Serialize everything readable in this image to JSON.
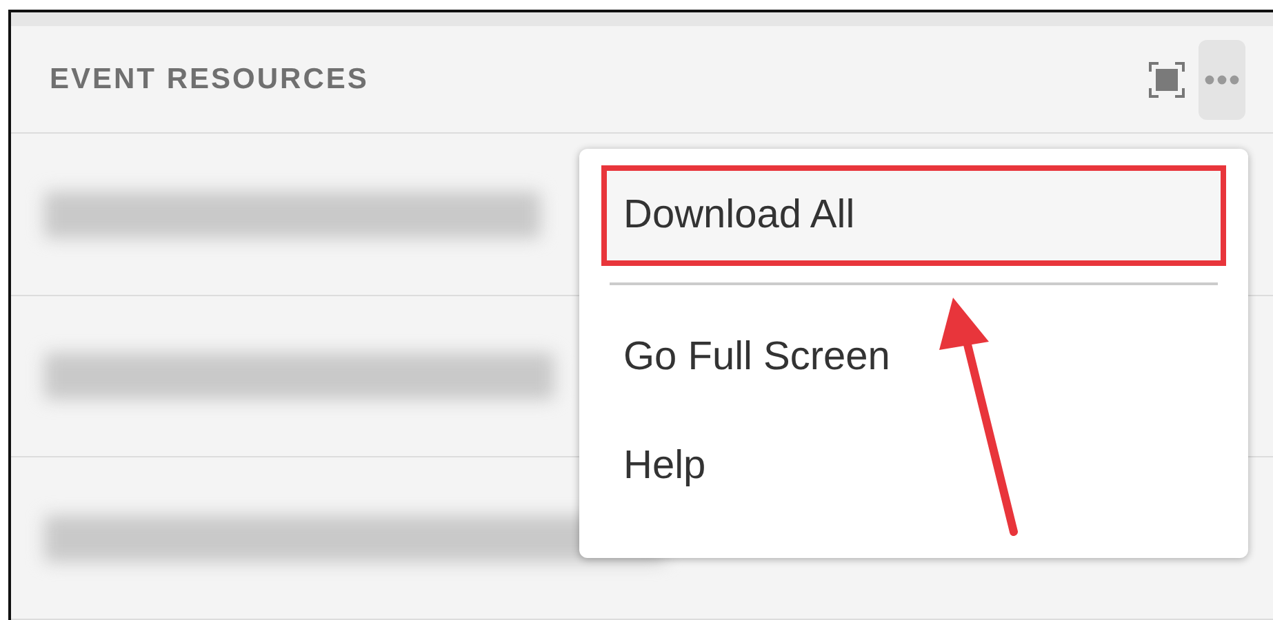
{
  "panel": {
    "title": "EVENT RESOURCES"
  },
  "toolbar": {
    "more_selected": true
  },
  "rows": [
    {
      "kind": "blurred"
    },
    {
      "kind": "blurred"
    },
    {
      "kind": "blurred"
    }
  ],
  "menu": {
    "items": [
      {
        "kind": "item",
        "label": "Download All",
        "highlighted": true
      },
      {
        "kind": "divider"
      },
      {
        "kind": "item",
        "label": "Go Full Screen",
        "highlighted": false
      },
      {
        "kind": "item",
        "label": "Help",
        "highlighted": false
      }
    ]
  },
  "annotation": {
    "kind": "arrow"
  }
}
